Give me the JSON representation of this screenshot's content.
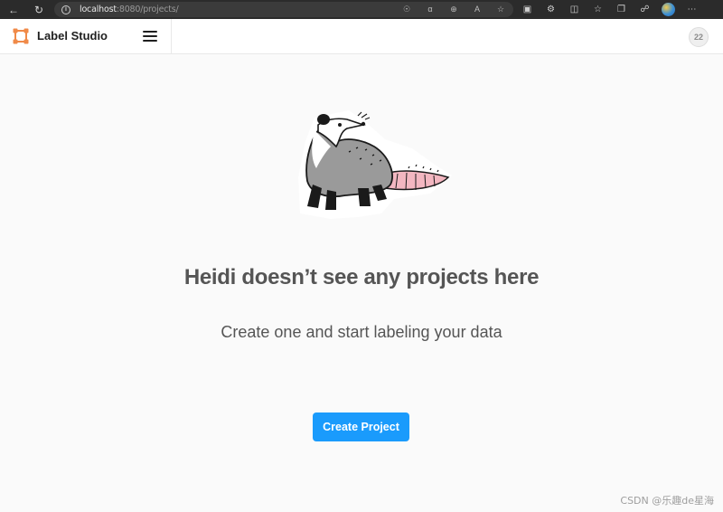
{
  "browser": {
    "url_host": "localhost",
    "url_rest": ":8080/projects/",
    "icons": [
      "back-icon",
      "reload-icon",
      "info-icon",
      "translate-icon",
      "zoom-icon",
      "read-aloud-icon",
      "favorite-icon",
      "reading-list-icon",
      "extensions-icon",
      "split-screen-icon",
      "favorites-icon",
      "collections-icon",
      "copilot-icon",
      "more-icon"
    ]
  },
  "header": {
    "brand": "Label Studio",
    "user_initials": "22"
  },
  "empty_state": {
    "title": "Heidi doesn’t see any projects here",
    "subtitle": "Create one and start labeling your data",
    "create_button": "Create Project"
  },
  "watermark": "CSDN @乐趣de星海",
  "colors": {
    "primary": "#1a9bfc",
    "text": "#555555",
    "background": "#fafafa",
    "logo": "#f08a48"
  }
}
